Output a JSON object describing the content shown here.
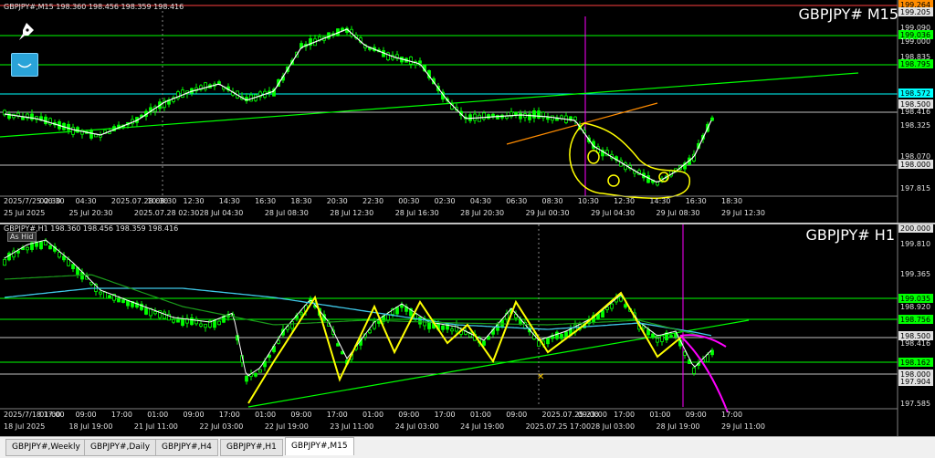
{
  "m15": {
    "header": "GBPJPY#,M15  198.360 198.456 198.359 198.416",
    "title": "GBPJPY# M15",
    "price_labels": [
      {
        "text": "199.264",
        "bg": "#ff8c00",
        "fg": "#000000"
      },
      {
        "text": "199.205",
        "bg": "#e0e0e0",
        "fg": "#000000"
      },
      {
        "text": "199.090",
        "bg": "",
        "fg": "#e0e0e0"
      },
      {
        "text": "199.036",
        "bg": "#00ff00",
        "fg": "#000000"
      },
      {
        "text": "199.000",
        "bg": "",
        "fg": "#e0e0e0"
      },
      {
        "text": "198.835",
        "bg": "",
        "fg": "#e0e0e0"
      },
      {
        "text": "198.795",
        "bg": "#00ff00",
        "fg": "#000000"
      },
      {
        "text": "198.572",
        "bg": "#00ffff",
        "fg": "#000000"
      },
      {
        "text": "198.500",
        "bg": "#e0e0e0",
        "fg": "#000000"
      },
      {
        "text": "198.416",
        "bg": "",
        "fg": "#e0e0e0"
      },
      {
        "text": "198.325",
        "bg": "",
        "fg": "#e0e0e0"
      },
      {
        "text": "198.070",
        "bg": "",
        "fg": "#e0e0e0"
      },
      {
        "text": "198.000",
        "bg": "#e0e0e0",
        "fg": "#000000"
      },
      {
        "text": "197.815",
        "bg": "",
        "fg": "#e0e0e0"
      }
    ],
    "time_row1": [
      "2025/7/25 00:30",
      "02:30",
      "04:30",
      "2025.07.28 08:30",
      "10:30",
      "12:30",
      "14:30",
      "16:30",
      "18:30",
      "20:30",
      "22:30",
      "00:30",
      "02:30",
      "04:30",
      "06:30",
      "08:30",
      "10:30",
      "12:30",
      "14:30",
      "16:30",
      "18:30"
    ],
    "time_row2": [
      "25 Jul 2025",
      "25 Jul 20:30",
      "2025.07.28 02:30",
      "28 Jul 04:30",
      "28 Jul 08:30",
      "28 Jul 12:30",
      "28 Jul 16:30",
      "28 Jul 20:30",
      "29 Jul 00:30",
      "29 Jul 04:30",
      "29 Jul 08:30",
      "29 Jul 12:30"
    ]
  },
  "h1": {
    "header": "GBPJPY#,H1  198.360 198.456 198.359 198.416",
    "badge": "As Hid",
    "title": "GBPJPY# H1",
    "price_labels": [
      {
        "text": "200.000",
        "bg": "#e0e0e0",
        "fg": "#000000"
      },
      {
        "text": "199.810",
        "bg": "",
        "fg": "#e0e0e0"
      },
      {
        "text": "199.365",
        "bg": "",
        "fg": "#e0e0e0"
      },
      {
        "text": "199.035",
        "bg": "#00ff00",
        "fg": "#000000"
      },
      {
        "text": "198.920",
        "bg": "",
        "fg": "#e0e0e0"
      },
      {
        "text": "198.756",
        "bg": "#00ff00",
        "fg": "#000000"
      },
      {
        "text": "198.500",
        "bg": "#e0e0e0",
        "fg": "#000000"
      },
      {
        "text": "198.416",
        "bg": "",
        "fg": "#e0e0e0"
      },
      {
        "text": "198.162",
        "bg": "#00ff00",
        "fg": "#000000"
      },
      {
        "text": "198.000",
        "bg": "#e0e0e0",
        "fg": "#000000"
      },
      {
        "text": "197.904",
        "bg": "#e0e0e0",
        "fg": "#000000"
      },
      {
        "text": "197.585",
        "bg": "",
        "fg": "#e0e0e0"
      }
    ],
    "time_row1": [
      "2025/7/18 17:00",
      "01:00",
      "09:00",
      "17:00",
      "01:00",
      "09:00",
      "17:00",
      "01:00",
      "09:00",
      "17:00",
      "01:00",
      "09:00",
      "17:00",
      "01:00",
      "09:00",
      "2025.07.25 23:00",
      "09:00",
      "17:00",
      "01:00",
      "09:00",
      "17:00"
    ],
    "time_row2": [
      "18 Jul 2025",
      "18 Jul 19:00",
      "21 Jul 11:00",
      "22 Jul 03:00",
      "22 Jul 19:00",
      "23 Jul 11:00",
      "24 Jul 03:00",
      "24 Jul 19:00",
      "2025.07.25 17:00",
      "28 Jul 03:00",
      "28 Jul 19:00",
      "29 Jul 11:00"
    ]
  },
  "tabs": [
    {
      "label": "GBPJPY#,Weekly",
      "active": false
    },
    {
      "label": "GBPJPY#,Daily",
      "active": false
    },
    {
      "label": "GBPJPY#,H4",
      "active": false
    },
    {
      "label": "GBPJPY#,H1",
      "active": false
    },
    {
      "label": "GBPJPY#,M15",
      "active": true
    }
  ],
  "colors": {
    "candle": "#00ff00",
    "trendline": "#00ff00",
    "ma_white": "#ffffff",
    "ma_cyan": "#3fc8e8",
    "zigzag": "#ffff00",
    "magenta": "#ff00ff",
    "orange": "#ff8c00",
    "highlight": "#ffff00"
  },
  "icons": [
    "pen-nib-icon",
    "smiley-face-icon"
  ]
}
